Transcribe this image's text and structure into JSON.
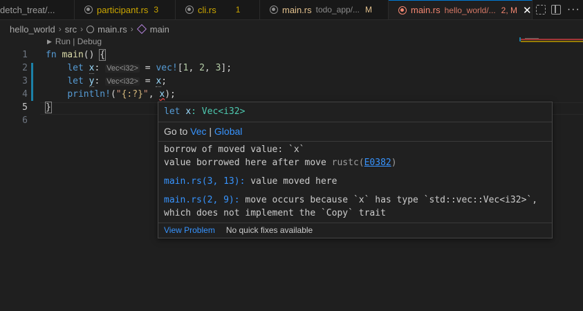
{
  "tabs": [
    {
      "name": "detch_treat/...",
      "desc": "",
      "badge": ""
    },
    {
      "name": "participant.rs",
      "desc": "",
      "badge": "3"
    },
    {
      "name": "cli.rs",
      "desc": "",
      "badge": "1"
    },
    {
      "name": "main.rs",
      "desc": "todo_app/...",
      "badge": "M"
    },
    {
      "name": "main.rs",
      "desc": "hello_world/...",
      "badge": "2, M",
      "close": "✕"
    }
  ],
  "colors": {
    "warning": "#cca700",
    "modified": "#e2c08d",
    "error": "#f48771",
    "accent": "#0078d4"
  },
  "breadcrumb": {
    "folder": "hello_world",
    "src": "src",
    "file": "main.rs",
    "symbol": "main",
    "sep": "›"
  },
  "codelens": {
    "run": "Run",
    "sep": " | ",
    "debug": "Debug"
  },
  "line_numbers": [
    "1",
    "2",
    "3",
    "4",
    "5",
    "6"
  ],
  "code": {
    "l1_kw": "fn",
    "l1_fn": "main",
    "l1_rest": "() ",
    "l1_brace": "{",
    "l2_kw": "let",
    "l2_var": "x",
    "l2_colon": ":",
    "l2_hint": "Vec<i32>",
    "l2_eq": " = ",
    "l2_mac": "vec!",
    "l2_open": "[",
    "l2_n1": "1",
    "l2_c1": ", ",
    "l2_n2": "2",
    "l2_c2": ", ",
    "l2_n3": "3",
    "l2_close": "];",
    "l3_kw": "let",
    "l3_var": "y",
    "l3_colon": ":",
    "l3_hint": "Vec<i32>",
    "l3_eq": " = ",
    "l3_x": "x",
    "l3_semi": ";",
    "l4_mac": "println!",
    "l4_open": "(",
    "l4_q1": "\"",
    "l4_fmt": "{:?}",
    "l4_q2": "\"",
    "l4_comma": ", ",
    "l4_x": "x",
    "l4_close": ");",
    "l5_brace": "}"
  },
  "hover": {
    "sig_kw": "let",
    "sig_var": "x",
    "sig_type": ": Vec<i32>",
    "goto_label": "Go to ",
    "goto_vec": "Vec",
    "goto_sep": " | ",
    "goto_global": "Global",
    "err_line1": "borrow of moved value: `x`",
    "err_line2": "value borrowed here after move ",
    "err_src": "rustc(",
    "err_code": "E0382",
    "err_src_close": ")",
    "rel1_loc": "main.rs(3, 13):",
    "rel1_msg": " value moved here",
    "rel2_loc": "main.rs(2, 9):",
    "rel2_msg": " move occurs because `x` has type `std::vec::Vec<i32>`,",
    "rel2_msg2": "which does not implement the `Copy` trait",
    "view_problem": "View Problem",
    "no_fixes": "No quick fixes available"
  },
  "actions": {
    "more": "···"
  }
}
